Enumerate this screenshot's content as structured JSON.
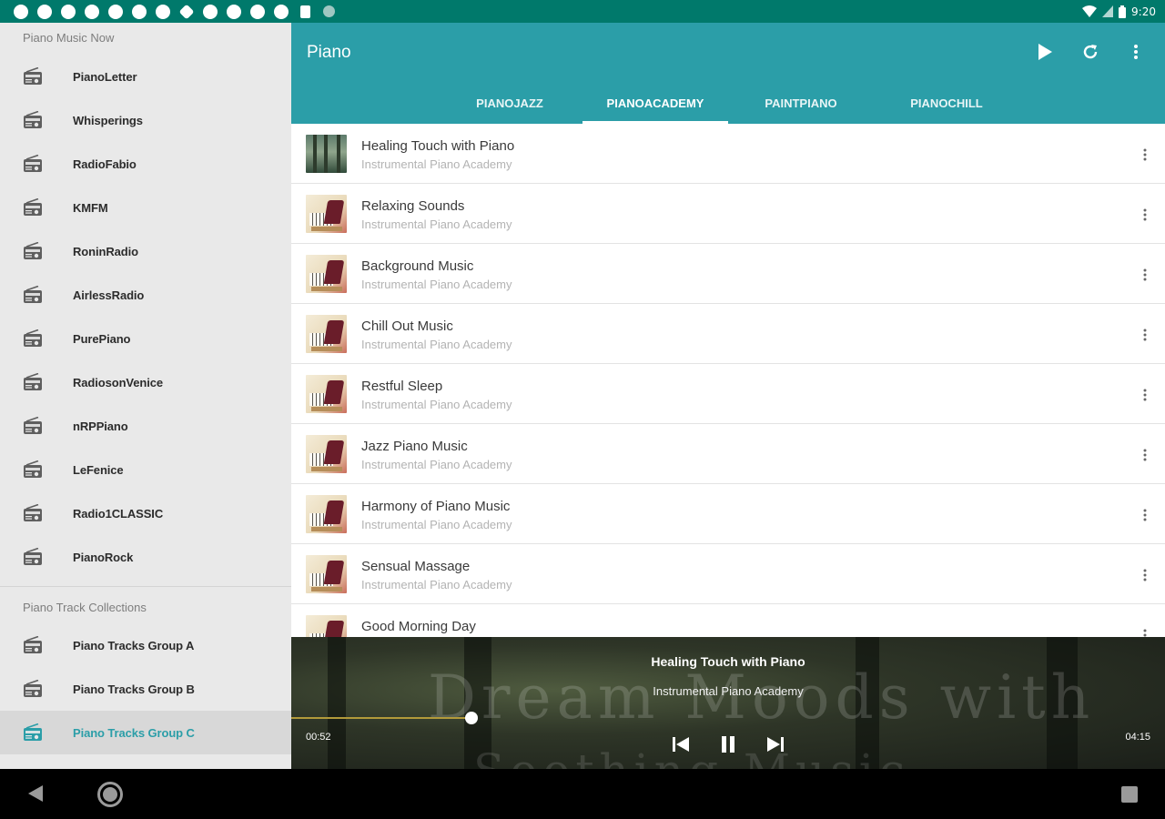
{
  "status_bar": {
    "time": "9:20",
    "notification_icons": [
      "app-notification-icon",
      "app-notification-icon",
      "app-notification-icon",
      "app-notification-icon",
      "app-notification-icon",
      "app-notification-icon",
      "app-notification-icon",
      "settings-icon",
      "app-notification-icon",
      "app-notification-icon",
      "app-notification-icon",
      "app-notification-icon",
      "sd-card-icon",
      "circle-icon"
    ],
    "indicators": [
      "wifi-icon",
      "signal-icon",
      "battery-icon"
    ]
  },
  "drawer": {
    "header": "Piano Music Now",
    "stations": [
      {
        "label": "PianoLetter",
        "icon": "radio-icon"
      },
      {
        "label": "Whisperings",
        "icon": "radio-icon"
      },
      {
        "label": "RadioFabio",
        "icon": "radio-icon"
      },
      {
        "label": "KMFM",
        "icon": "radio-icon"
      },
      {
        "label": "RoninRadio",
        "icon": "radio-icon"
      },
      {
        "label": "AirlessRadio",
        "icon": "radio-icon"
      },
      {
        "label": "PurePiano",
        "icon": "radio-icon"
      },
      {
        "label": "RadiosonVenice",
        "icon": "radio-icon"
      },
      {
        "label": "nRPPiano",
        "icon": "radio-icon"
      },
      {
        "label": "LeFenice",
        "icon": "radio-icon"
      },
      {
        "label": "Radio1CLASSIC",
        "icon": "radio-icon"
      },
      {
        "label": "PianoRock",
        "icon": "radio-icon"
      }
    ],
    "section_header": "Piano Track Collections",
    "collections": [
      {
        "label": "Piano Tracks Group A",
        "icon": "radio-icon",
        "active": false
      },
      {
        "label": "Piano Tracks Group B",
        "icon": "radio-icon",
        "active": false
      },
      {
        "label": "Piano Tracks Group C",
        "icon": "radio-icon",
        "active": true
      }
    ]
  },
  "appbar": {
    "title": "Piano",
    "actions": [
      "play-icon",
      "refresh-icon",
      "more-vert-icon"
    ],
    "tabs": [
      {
        "label": "PIANOJAZZ",
        "selected": false
      },
      {
        "label": "PIANOACADEMY",
        "selected": true
      },
      {
        "label": "PAINTPIANO",
        "selected": false
      },
      {
        "label": "PIANOCHILL",
        "selected": false
      }
    ]
  },
  "tracks": [
    {
      "title": "Healing Touch with Piano",
      "artist": "Instrumental Piano Academy",
      "thumb": "forest"
    },
    {
      "title": "Relaxing Sounds",
      "artist": "Instrumental Piano Academy",
      "thumb": "piano"
    },
    {
      "title": "Background Music",
      "artist": "Instrumental Piano Academy",
      "thumb": "piano"
    },
    {
      "title": "Chill Out Music",
      "artist": "Instrumental Piano Academy",
      "thumb": "piano"
    },
    {
      "title": "Restful Sleep",
      "artist": "Instrumental Piano Academy",
      "thumb": "piano"
    },
    {
      "title": "Jazz Piano Music",
      "artist": "Instrumental Piano Academy",
      "thumb": "piano"
    },
    {
      "title": "Harmony of Piano Music",
      "artist": "Instrumental Piano Academy",
      "thumb": "piano"
    },
    {
      "title": "Sensual Massage",
      "artist": "Instrumental Piano Academy",
      "thumb": "piano"
    },
    {
      "title": "Good Morning Day",
      "artist": "",
      "thumb": "piano"
    }
  ],
  "player": {
    "title": "Healing Touch with Piano",
    "artist": "Instrumental Piano Academy",
    "artwork_text_line1": "Dream Moods with",
    "artwork_text_line2": "Soothing Music",
    "elapsed": "00:52",
    "total": "04:15",
    "progress": 0.206,
    "controls": [
      "skip-previous-icon",
      "pause-icon",
      "skip-next-icon"
    ]
  },
  "colors": {
    "primary": "#2b9ea8",
    "status_bar": "#00796b",
    "drawer_bg": "#e9e9e9",
    "active_item": "#2b9ea8",
    "seek": "#b29a3a"
  }
}
